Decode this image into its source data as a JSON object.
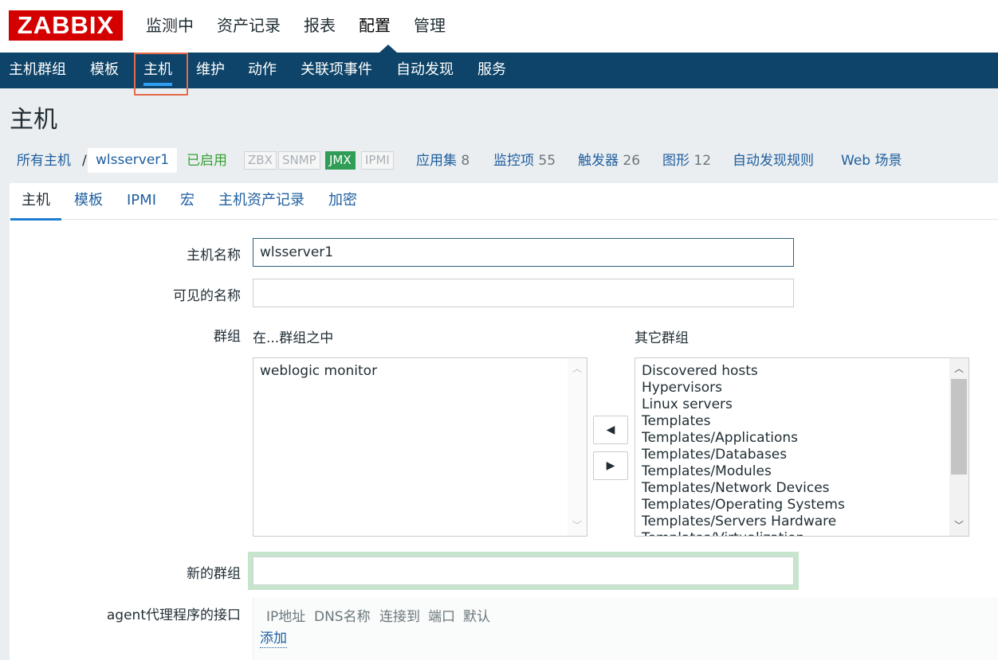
{
  "logo": "ZABBIX",
  "main_menu": [
    "监测中",
    "资产记录",
    "报表",
    "配置",
    "管理"
  ],
  "sub_nav": [
    "主机群组",
    "模板",
    "主机",
    "维护",
    "动作",
    "关联项事件",
    "自动发现",
    "服务"
  ],
  "page_title": "主机",
  "breadcrumb": {
    "all_hosts": "所有主机",
    "sep": "/",
    "host": "wlsserver1"
  },
  "status": "已启用",
  "availability": [
    {
      "label": "ZBX",
      "active": false
    },
    {
      "label": "SNMP",
      "active": false
    },
    {
      "label": "JMX",
      "active": true
    },
    {
      "label": "IPMI",
      "active": false
    }
  ],
  "host_links": [
    {
      "label": "应用集",
      "count": "8"
    },
    {
      "label": "监控项",
      "count": "55"
    },
    {
      "label": "触发器",
      "count": "26"
    },
    {
      "label": "图形",
      "count": "12"
    },
    {
      "label": "自动发现规则",
      "count": ""
    },
    {
      "label": "Web 场景",
      "count": ""
    }
  ],
  "tabs": [
    "主机",
    "模板",
    "IPMI",
    "宏",
    "主机资产记录",
    "加密"
  ],
  "form": {
    "host_name_label": "主机名称",
    "host_name_value": "wlsserver1",
    "visible_name_label": "可见的名称",
    "visible_name_value": "",
    "groups_label": "群组",
    "in_groups_label": "在...群组之中",
    "other_groups_label": "其它群组",
    "in_groups": [
      "weblogic monitor"
    ],
    "other_groups": [
      "Discovered hosts",
      "Hypervisors",
      "Linux servers",
      "Templates",
      "Templates/Applications",
      "Templates/Databases",
      "Templates/Modules",
      "Templates/Network Devices",
      "Templates/Operating Systems",
      "Templates/Servers Hardware",
      "Templates/Virtualization"
    ],
    "move_left": "◀",
    "move_right": "▶",
    "new_group_label": "新的群组",
    "new_group_value": "",
    "agent_iface_label": "agent代理程序的接口",
    "iface_headers": [
      "IP地址",
      "DNS名称",
      "连接到",
      "端口",
      "默认"
    ],
    "add_link": "添加"
  }
}
